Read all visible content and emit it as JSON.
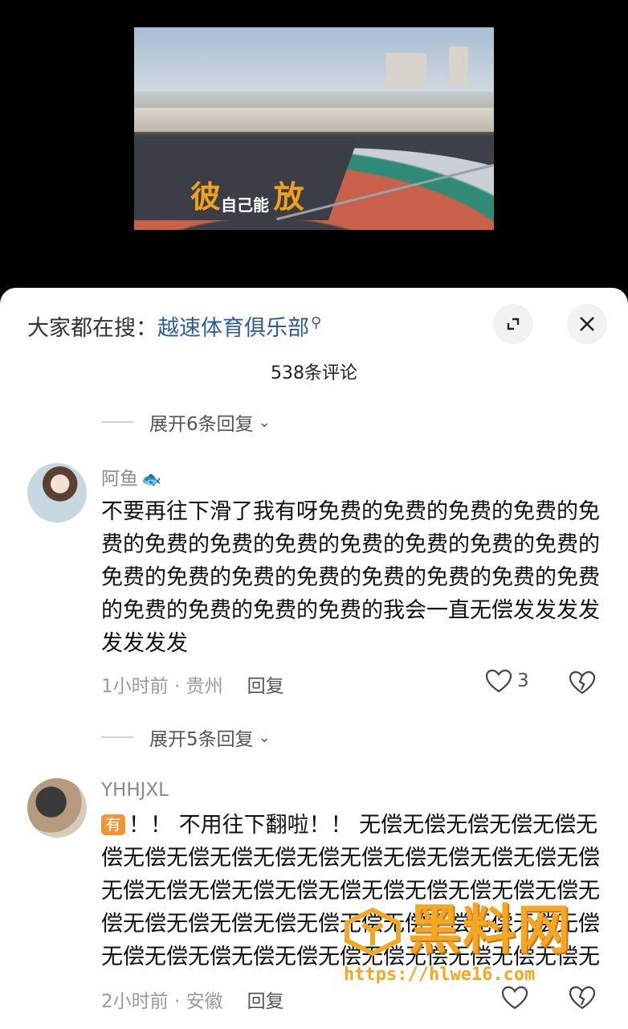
{
  "video": {
    "caption_left": "彼",
    "caption_mid": "自己能",
    "caption_right": "放"
  },
  "sheet": {
    "search_prefix": "大家都在搜：",
    "search_keyword": "越速体育俱乐部",
    "comment_count": "538条评论"
  },
  "expand_top": "展开6条回复",
  "comment1": {
    "username": "阿鱼",
    "text": "不要再往下滑了我有呀免费的免费的免费的免费的免费的免费的免费的免费的免费的免费的免费的免费的免费的免费的免费的免费的免费的免费的免费的免费的免费的免费的免费的免费的我会一直无偿发发发发发发发发",
    "time": "1小时前",
    "location": "贵州",
    "reply": "回复",
    "likes": "3"
  },
  "expand_mid": "展开5条回复",
  "comment2": {
    "username": "YHHJXL",
    "badge": "有",
    "text": "！！ 不用往下翻啦！！ 无偿无偿无偿无偿无偿无偿无偿无偿无偿无偿无偿无偿无偿无偿无偿无偿无偿无偿无偿无偿无偿无偿无偿无偿无偿无偿无偿无偿无偿无偿无偿无偿无偿无偿无偿无偿无偿无偿无偿无偿无偿无偿无偿无偿无偿无偿无偿无偿无偿无偿无偿无偿无偿无偿无偿无偿无偿无偿无偿无偿无偿无偿无偿无偿无偿无偿无偿无偿",
    "text_short": "！！ 不用往下翻啦！！ 无偿无偿无偿无偿无偿无偿无偿无偿无偿无偿无偿无偿无偿无偿无偿无偿无偿无偿无偿无偿无偿无偿无偿无偿无偿无偿无偿无偿无偿无偿无偿无偿无偿无偿无偿无偿无偿无偿无偿无偿无偿无偿无偿无偿无偿无偿无偿无偿无偿无偿无偿无偿无偿无偿无偿无偿无偿无偿无偿无偿无偿无偿无偿无偿",
    "time": "2小时前",
    "location": "安徽",
    "reply": "回复"
  },
  "watermark": {
    "title": "黑料网",
    "url": "https://hlwe16.com"
  },
  "colors": {
    "keyword": "#2f5b9a",
    "badge": "#f0953a",
    "watermark": "#f5a623"
  }
}
